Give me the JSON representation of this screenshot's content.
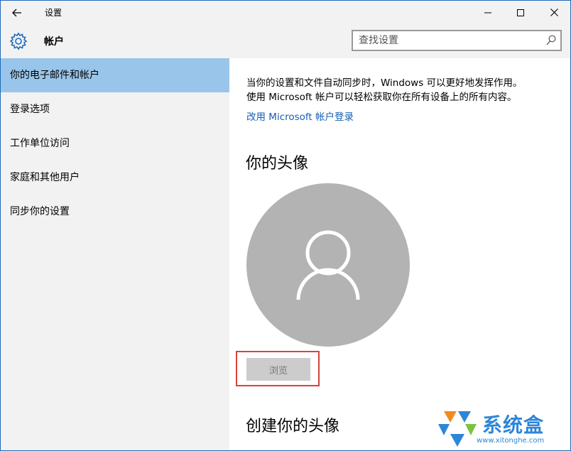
{
  "window": {
    "title": "设置"
  },
  "header": {
    "title": "帐户"
  },
  "search": {
    "placeholder": "查找设置"
  },
  "sidebar": {
    "items": [
      {
        "label": "你的电子邮件和帐户",
        "selected": true
      },
      {
        "label": "登录选项",
        "selected": false
      },
      {
        "label": "工作单位访问",
        "selected": false
      },
      {
        "label": "家庭和其他用户",
        "selected": false
      },
      {
        "label": "同步你的设置",
        "selected": false
      }
    ]
  },
  "main": {
    "description_line1": "当你的设置和文件自动同步时，Windows 可以更好地发挥作用。",
    "description_line2": "使用 Microsoft 帐户可以轻松获取你在所有设备上的所有内容。",
    "ms_login_link": "改用 Microsoft 帐户登录",
    "avatar_section_title": "你的头像",
    "browse_label": "浏览",
    "create_avatar_title": "创建你的头像"
  },
  "watermark": {
    "brand": "系统盒",
    "url": "www.xitonghe.com"
  },
  "icons": {
    "back": "back-arrow-icon",
    "settings": "gear-icon",
    "search": "search-icon",
    "minimize": "minimize-icon",
    "maximize": "maximize-icon",
    "close": "close-icon",
    "avatar": "user-avatar-icon"
  },
  "colors": {
    "accent": "#1e6bb8",
    "selected_nav": "#99c5ea",
    "link": "#1460b4",
    "avatar_bg": "#b3b3b3",
    "highlight": "#d9433a"
  }
}
